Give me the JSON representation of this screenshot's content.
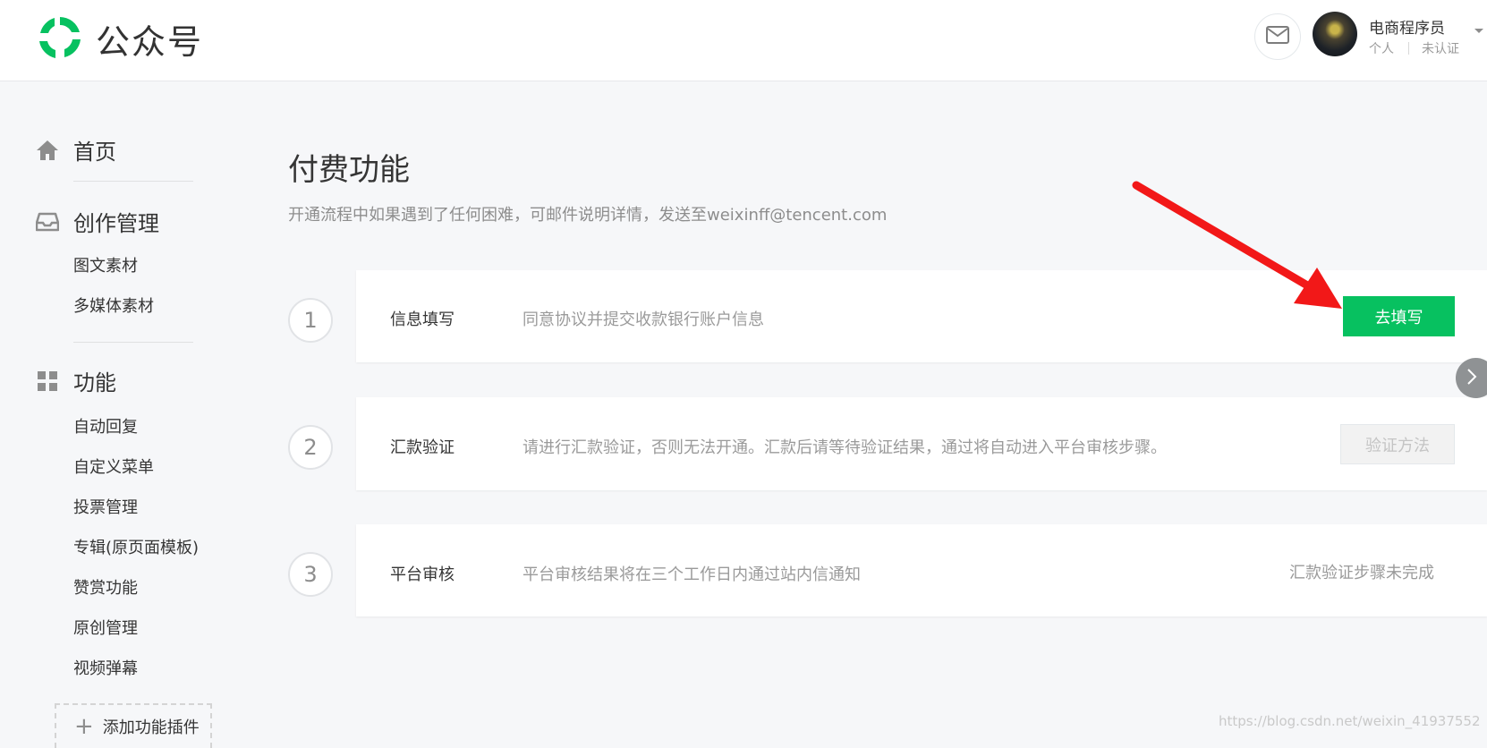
{
  "header": {
    "logo_text": "公众号",
    "account_name": "电商程序员",
    "account_type": "个人",
    "account_status": "未认证",
    "mail_icon": "mail-icon"
  },
  "sidebar": {
    "home_label": "首页",
    "creation_label": "创作管理",
    "creation_items": [
      "图文素材",
      "多媒体素材"
    ],
    "function_label": "功能",
    "function_items": [
      "自动回复",
      "自定义菜单",
      "投票管理",
      "专辑(原页面模板)",
      "赞赏功能",
      "原创管理",
      "视频弹幕"
    ],
    "add_plugin_label": "添加功能插件"
  },
  "main": {
    "title": "付费功能",
    "description": "开通流程中如果遇到了任何困难，可邮件说明详情，发送至weixinff@tencent.com",
    "steps": [
      {
        "number": "1",
        "title": "信息填写",
        "desc": "同意协议并提交收款银行账户信息",
        "action": "去填写"
      },
      {
        "number": "2",
        "title": "汇款验证",
        "desc": "请进行汇款验证，否则无法开通。汇款后请等待验证结果，通过将自动进入平台审核步骤。",
        "action": "验证方法"
      },
      {
        "number": "3",
        "title": "平台审核",
        "desc": "平台审核结果将在三个工作日内通过站内信通知",
        "status": "汇款验证步骤未完成"
      }
    ]
  },
  "watermark": "https://blog.csdn.net/weixin_41937552",
  "colors": {
    "primary": "#07c160",
    "annotation_arrow": "#f21818",
    "background": "#f6f7f9"
  }
}
